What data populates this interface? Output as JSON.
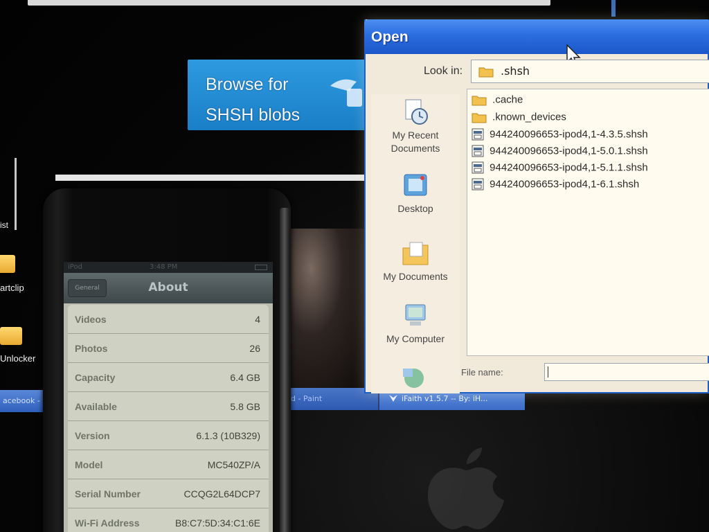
{
  "desktop": {
    "banner_line1": "Browse for",
    "banner_line2": "SHSH blobs",
    "icon_1_label": "artclip",
    "icon_2_label": "Unlocker",
    "left_task_label": "acebook -",
    "task_paint_label": "d - Paint",
    "task_ifaith_label": "iFaith v1.5.7 -- By: iH...",
    "left_edge_text": "ist"
  },
  "dialog": {
    "title": "Open",
    "look_in_label": "Look in:",
    "look_in_value": ".shsh",
    "places": [
      {
        "label": "My Recent Documents",
        "icon": "recent-documents-icon"
      },
      {
        "label": "Desktop",
        "icon": "desktop-icon"
      },
      {
        "label": "My Documents",
        "icon": "my-documents-icon"
      },
      {
        "label": "My Computer",
        "icon": "my-computer-icon"
      }
    ],
    "files": [
      {
        "name": ".cache",
        "type": "folder"
      },
      {
        "name": ".known_devices",
        "type": "folder"
      },
      {
        "name": "944240096653-ipod4,1-4.3.5.shsh",
        "type": "file"
      },
      {
        "name": "944240096653-ipod4,1-5.0.1.shsh",
        "type": "file"
      },
      {
        "name": "944240096653-ipod4,1-5.1.1.shsh",
        "type": "file"
      },
      {
        "name": "944240096653-ipod4,1-6.1.shsh",
        "type": "file"
      }
    ],
    "file_name_label": "File name:",
    "file_name_value": ""
  },
  "ipod": {
    "carrier": "iPod",
    "time": "3:48 PM",
    "back_label": "General",
    "nav_title": "About",
    "rows": [
      {
        "label": "Videos",
        "value": "4"
      },
      {
        "label": "Photos",
        "value": "26"
      },
      {
        "label": "Capacity",
        "value": "6.4 GB"
      },
      {
        "label": "Available",
        "value": "5.8 GB"
      },
      {
        "label": "Version",
        "value": "6.1.3 (10B329)"
      },
      {
        "label": "Model",
        "value": "MC540ZP/A"
      },
      {
        "label": "Serial Number",
        "value": "CCQG2L64DCP7"
      },
      {
        "label": "Wi-Fi Address",
        "value": "B8:C7:5D:34:C1:6E"
      }
    ]
  },
  "colors": {
    "xp_title_blue": "#2b6de0",
    "banner_blue": "#1a7fc8",
    "dialog_bg": "#f1eadb"
  }
}
